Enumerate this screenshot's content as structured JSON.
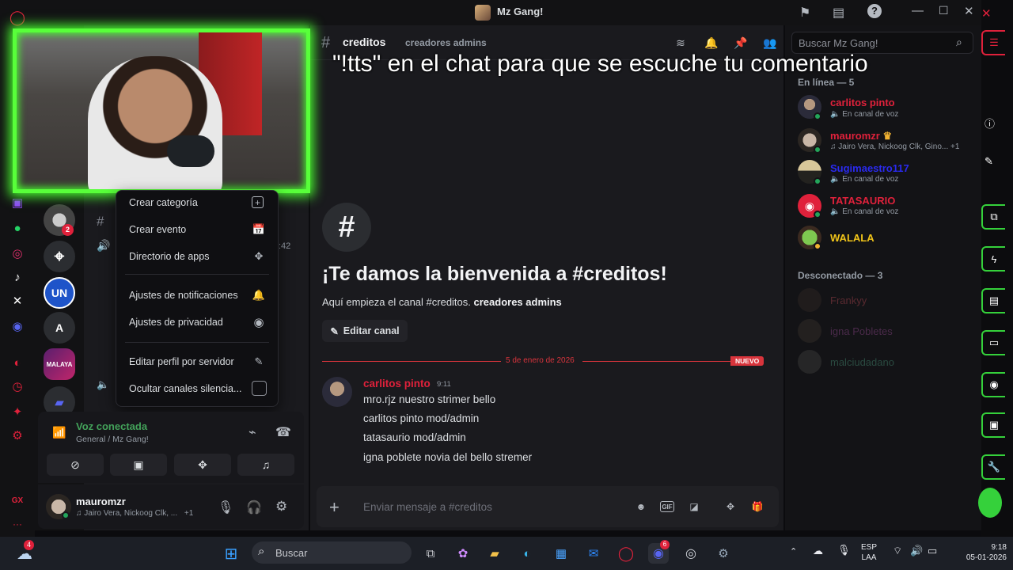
{
  "window": {
    "title": "Mz Gang!"
  },
  "overlay": {
    "subtitle": "\"!tts\" en el chat para que se escuche tu comentario"
  },
  "context_menu": {
    "items": [
      {
        "label": "Crear categoría",
        "icon": "plus-box-icon"
      },
      {
        "label": "Crear evento",
        "icon": "calendar-plus-icon"
      },
      {
        "label": "Directorio de apps",
        "icon": "apps-grid-icon"
      },
      {
        "label": "Ajustes de notificaciones",
        "icon": "bell-icon"
      },
      {
        "label": "Ajustes de privacidad",
        "icon": "shield-icon"
      },
      {
        "label": "Editar perfil por servidor",
        "icon": "pencil-icon"
      },
      {
        "label": "Ocultar canales silencia...",
        "icon": "checkbox-icon"
      }
    ]
  },
  "channels": {
    "voice_time": ":42",
    "server_badge": "2",
    "server_letter": "A"
  },
  "voice_panel": {
    "title": "Voz conectada",
    "subtitle": "General / Mz Gang!"
  },
  "user_panel": {
    "name": "mauromzr",
    "status": "♫ Jairo Vera, Nickoog Clk, ...",
    "extra": "+1"
  },
  "chat_header": {
    "channel": "creditos",
    "topic": "creadores admins"
  },
  "welcome": {
    "title": "¡Te damos la bienvenida a #creditos!",
    "sub_prefix": "Aquí empieza el canal #creditos.",
    "sub_bold": "creadores admins",
    "edit_button": "Editar canal"
  },
  "divider": {
    "date": "5 de enero de 2026",
    "badge": "NUEVO"
  },
  "message": {
    "author": "carlitos pinto",
    "time": "9:11",
    "lines": [
      "mro.rjz nuestro strimer bello",
      "carlitos pinto mod/admin",
      "tatasaurio mod/admin",
      "igna poblete novia del bello stremer"
    ]
  },
  "composer": {
    "placeholder": "Enviar mensaje a #creditos"
  },
  "search": {
    "placeholder": "Buscar Mz Gang!"
  },
  "members": {
    "online_title": "En línea — 5",
    "online": [
      {
        "name": "carlitos pinto",
        "status": "En canal de voz",
        "color": "#e0213b"
      },
      {
        "name": "mauromzr",
        "status": "♫ Jairo Vera, Nickoog Clk, Gino...",
        "extra": "+1",
        "color": "#e0213b"
      },
      {
        "name": "Sugimaestro117",
        "status": "En canal de voz",
        "color": "#2a2af0"
      },
      {
        "name": "TATASAURIO",
        "status": "En canal de voz",
        "color": "#e0213b"
      },
      {
        "name": "WALALA",
        "status": "",
        "color": "#f0c419"
      }
    ],
    "offline_title": "Desconectado — 3",
    "offline": [
      {
        "name": "Frankyy",
        "color": "#5a2a30"
      },
      {
        "name": "igna Pobletes",
        "color": "#4a2a4a"
      },
      {
        "name": "malciudadano",
        "color": "#2a4a40"
      }
    ]
  },
  "taskbar": {
    "search_label": "Buscar",
    "weather_badge": "4",
    "discord_badge": "6",
    "lang_top": "ESP",
    "lang_bottom": "LAA",
    "time": "9:18",
    "date": "05-01-2026"
  },
  "colors": {
    "opera_red": "#e0213b",
    "webcam_border": "#58ff3a",
    "voice_green": "#43a25a",
    "new_red": "#d8343c"
  }
}
